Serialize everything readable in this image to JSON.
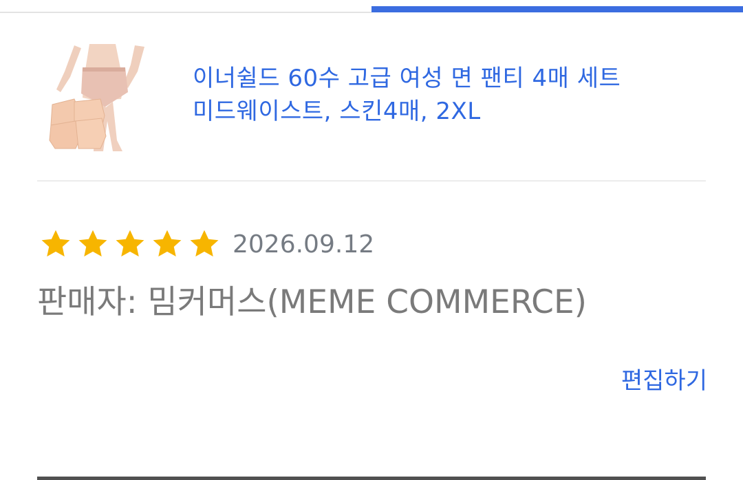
{
  "tabs": {
    "active_color": "#3b6de0",
    "inactive_color": "#e3e3e3"
  },
  "product": {
    "image_icon": "product-photo",
    "title_line1": "이너쉴드 60수 고급 여성 면 팬티 4매 세트",
    "title_line2": "미드웨이스트, 스킨4매, 2XL"
  },
  "review": {
    "rating": 5,
    "rating_max": 5,
    "star_color": "#f7b500",
    "date": "2026.09.12",
    "seller_prefix": "판매자: ",
    "seller_name": "밈커머스(MEME COMMERCE)"
  },
  "actions": {
    "edit_label": "편집하기"
  },
  "colors": {
    "link_blue": "#2f68e1",
    "text_gray": "#7a7a7a"
  }
}
